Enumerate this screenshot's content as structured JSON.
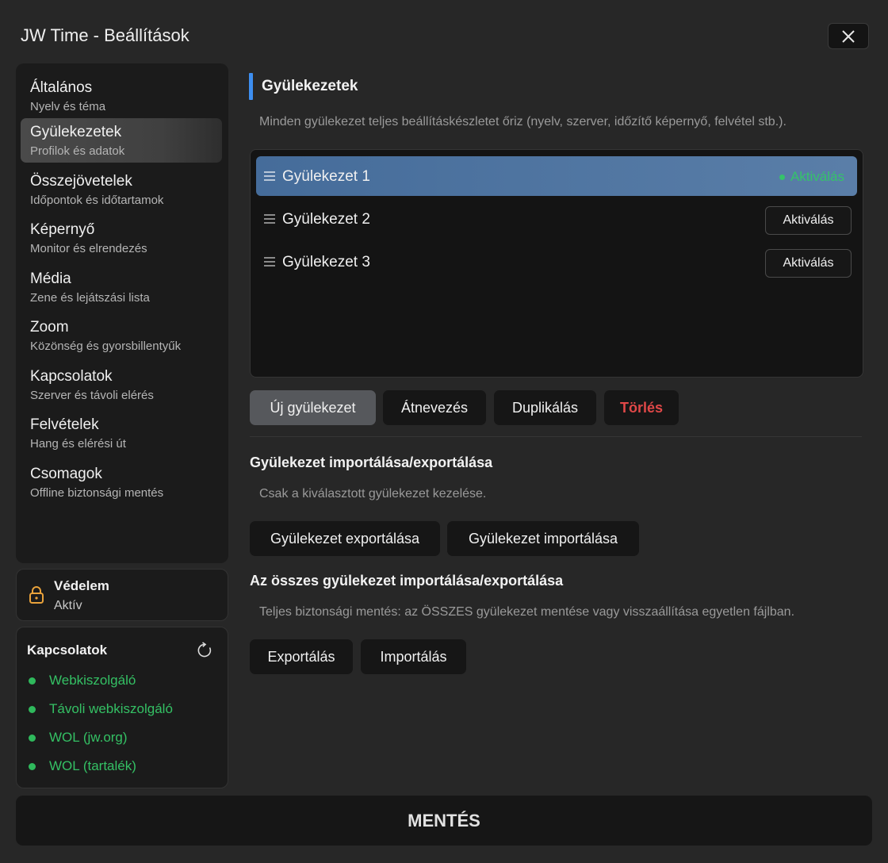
{
  "window": {
    "title": "JW Time - Beállítások"
  },
  "sidebar": {
    "items": [
      {
        "label": "Általános",
        "sub": "Nyelv és téma"
      },
      {
        "label": "Gyülekezetek",
        "sub": "Profilok és adatok"
      },
      {
        "label": "Összejövetelek",
        "sub": "Időpontok és időtartamok"
      },
      {
        "label": "Képernyő",
        "sub": "Monitor és elrendezés"
      },
      {
        "label": "Média",
        "sub": "Zene és lejátszási lista"
      },
      {
        "label": "Zoom",
        "sub": "Közönség és gyorsbillentyűk"
      },
      {
        "label": "Kapcsolatok",
        "sub": "Szerver és távoli elérés"
      },
      {
        "label": "Felvételek",
        "sub": "Hang és elérési út"
      },
      {
        "label": "Csomagok",
        "sub": "Offline biztonsági mentés"
      }
    ],
    "active_index": 1
  },
  "protection": {
    "title": "Védelem",
    "status": "Aktív",
    "icon": "lock-icon"
  },
  "connections": {
    "title": "Kapcsolatok",
    "items": [
      {
        "name": "Webkiszolgáló",
        "status_color": "#2fb95c"
      },
      {
        "name": "Távoli webkiszolgáló",
        "status_color": "#2fb95c"
      },
      {
        "name": "WOL (jw.org)",
        "status_color": "#2fb95c"
      },
      {
        "name": "WOL (tartalék)",
        "status_color": "#2fb95c"
      }
    ]
  },
  "main": {
    "section_title": "Gyülekezetek",
    "section_desc": "Minden gyülekezet teljes beállításkészletet őriz (nyelv, szerver, időzítő képernyő, felvétel stb.).",
    "congregations": [
      {
        "name": "Gyülekezet 1",
        "active": true,
        "action": "Aktiválás"
      },
      {
        "name": "Gyülekezet 2",
        "active": false,
        "action": "Aktiválás"
      },
      {
        "name": "Gyülekezet 3",
        "active": false,
        "action": "Aktiválás"
      }
    ],
    "actions": {
      "new": "Új gyülekezet",
      "rename": "Átnevezés",
      "duplicate": "Duplikálás",
      "delete": "Törlés"
    },
    "single_io": {
      "title": "Gyülekezet importálása/exportálása",
      "desc": "Csak a kiválasztott gyülekezet kezelése.",
      "export": "Gyülekezet exportálása",
      "import": "Gyülekezet importálása"
    },
    "all_io": {
      "title": "Az összes gyülekezet importálása/exportálása",
      "desc": "Teljes biztonsági mentés: az ÖSSZES gyülekezet mentése vagy visszaállítása egyetlen fájlban.",
      "export": "Exportálás",
      "import": "Importálás"
    }
  },
  "footer": {
    "save_label": "MENTÉS"
  },
  "colors": {
    "accent": "#3d8ef0",
    "active_row": "#4f77a3",
    "success": "#35c36a",
    "danger": "#e04848"
  }
}
